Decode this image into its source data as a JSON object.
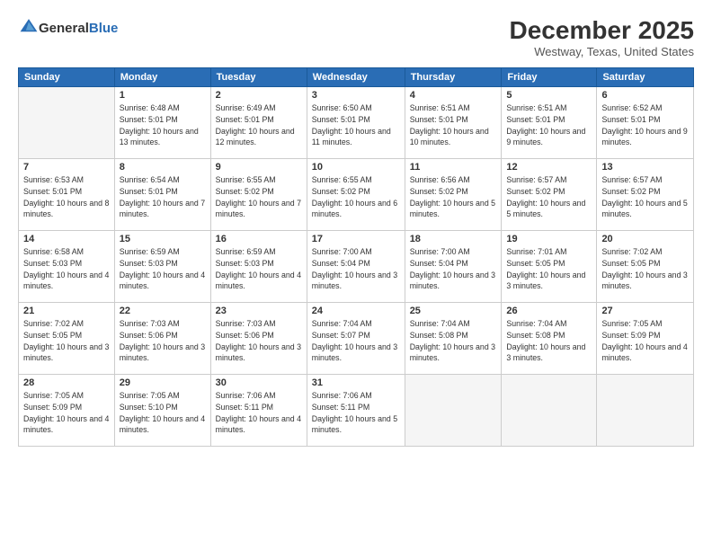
{
  "logo": {
    "general": "General",
    "blue": "Blue"
  },
  "header": {
    "month": "December 2025",
    "location": "Westway, Texas, United States"
  },
  "days_of_week": [
    "Sunday",
    "Monday",
    "Tuesday",
    "Wednesday",
    "Thursday",
    "Friday",
    "Saturday"
  ],
  "weeks": [
    [
      {
        "day": "",
        "empty": true
      },
      {
        "day": "1",
        "sunrise": "6:48 AM",
        "sunset": "5:01 PM",
        "daylight": "10 hours and 13 minutes."
      },
      {
        "day": "2",
        "sunrise": "6:49 AM",
        "sunset": "5:01 PM",
        "daylight": "10 hours and 12 minutes."
      },
      {
        "day": "3",
        "sunrise": "6:50 AM",
        "sunset": "5:01 PM",
        "daylight": "10 hours and 11 minutes."
      },
      {
        "day": "4",
        "sunrise": "6:51 AM",
        "sunset": "5:01 PM",
        "daylight": "10 hours and 10 minutes."
      },
      {
        "day": "5",
        "sunrise": "6:51 AM",
        "sunset": "5:01 PM",
        "daylight": "10 hours and 9 minutes."
      },
      {
        "day": "6",
        "sunrise": "6:52 AM",
        "sunset": "5:01 PM",
        "daylight": "10 hours and 9 minutes."
      }
    ],
    [
      {
        "day": "7",
        "sunrise": "6:53 AM",
        "sunset": "5:01 PM",
        "daylight": "10 hours and 8 minutes."
      },
      {
        "day": "8",
        "sunrise": "6:54 AM",
        "sunset": "5:01 PM",
        "daylight": "10 hours and 7 minutes."
      },
      {
        "day": "9",
        "sunrise": "6:55 AM",
        "sunset": "5:02 PM",
        "daylight": "10 hours and 7 minutes."
      },
      {
        "day": "10",
        "sunrise": "6:55 AM",
        "sunset": "5:02 PM",
        "daylight": "10 hours and 6 minutes."
      },
      {
        "day": "11",
        "sunrise": "6:56 AM",
        "sunset": "5:02 PM",
        "daylight": "10 hours and 5 minutes."
      },
      {
        "day": "12",
        "sunrise": "6:57 AM",
        "sunset": "5:02 PM",
        "daylight": "10 hours and 5 minutes."
      },
      {
        "day": "13",
        "sunrise": "6:57 AM",
        "sunset": "5:02 PM",
        "daylight": "10 hours and 5 minutes."
      }
    ],
    [
      {
        "day": "14",
        "sunrise": "6:58 AM",
        "sunset": "5:03 PM",
        "daylight": "10 hours and 4 minutes."
      },
      {
        "day": "15",
        "sunrise": "6:59 AM",
        "sunset": "5:03 PM",
        "daylight": "10 hours and 4 minutes."
      },
      {
        "day": "16",
        "sunrise": "6:59 AM",
        "sunset": "5:03 PM",
        "daylight": "10 hours and 4 minutes."
      },
      {
        "day": "17",
        "sunrise": "7:00 AM",
        "sunset": "5:04 PM",
        "daylight": "10 hours and 3 minutes."
      },
      {
        "day": "18",
        "sunrise": "7:00 AM",
        "sunset": "5:04 PM",
        "daylight": "10 hours and 3 minutes."
      },
      {
        "day": "19",
        "sunrise": "7:01 AM",
        "sunset": "5:05 PM",
        "daylight": "10 hours and 3 minutes."
      },
      {
        "day": "20",
        "sunrise": "7:02 AM",
        "sunset": "5:05 PM",
        "daylight": "10 hours and 3 minutes."
      }
    ],
    [
      {
        "day": "21",
        "sunrise": "7:02 AM",
        "sunset": "5:05 PM",
        "daylight": "10 hours and 3 minutes."
      },
      {
        "day": "22",
        "sunrise": "7:03 AM",
        "sunset": "5:06 PM",
        "daylight": "10 hours and 3 minutes."
      },
      {
        "day": "23",
        "sunrise": "7:03 AM",
        "sunset": "5:06 PM",
        "daylight": "10 hours and 3 minutes."
      },
      {
        "day": "24",
        "sunrise": "7:04 AM",
        "sunset": "5:07 PM",
        "daylight": "10 hours and 3 minutes."
      },
      {
        "day": "25",
        "sunrise": "7:04 AM",
        "sunset": "5:08 PM",
        "daylight": "10 hours and 3 minutes."
      },
      {
        "day": "26",
        "sunrise": "7:04 AM",
        "sunset": "5:08 PM",
        "daylight": "10 hours and 3 minutes."
      },
      {
        "day": "27",
        "sunrise": "7:05 AM",
        "sunset": "5:09 PM",
        "daylight": "10 hours and 4 minutes."
      }
    ],
    [
      {
        "day": "28",
        "sunrise": "7:05 AM",
        "sunset": "5:09 PM",
        "daylight": "10 hours and 4 minutes."
      },
      {
        "day": "29",
        "sunrise": "7:05 AM",
        "sunset": "5:10 PM",
        "daylight": "10 hours and 4 minutes."
      },
      {
        "day": "30",
        "sunrise": "7:06 AM",
        "sunset": "5:11 PM",
        "daylight": "10 hours and 4 minutes."
      },
      {
        "day": "31",
        "sunrise": "7:06 AM",
        "sunset": "5:11 PM",
        "daylight": "10 hours and 5 minutes."
      },
      {
        "day": "",
        "empty": true
      },
      {
        "day": "",
        "empty": true
      },
      {
        "day": "",
        "empty": true
      }
    ]
  ]
}
